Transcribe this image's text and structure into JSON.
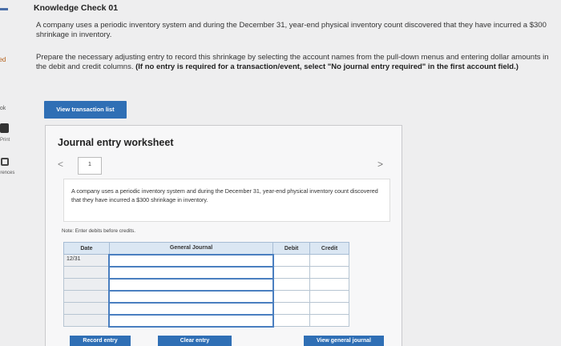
{
  "sidebar": {
    "badge": "ped",
    "book": "ook",
    "print": "Print",
    "references": "erences"
  },
  "page": {
    "title": "Knowledge Check 01",
    "paragraph1": "A company uses a periodic inventory system and during the December 31, year-end physical inventory count discovered that they have incurred a $300 shrinkage in inventory.",
    "paragraph2": "Prepare the necessary adjusting entry to record this shrinkage by selecting the account names from the pull-down menus and entering dollar amounts in the debit and credit columns.",
    "paragraph2_bold": "(If no entry is required for a transaction/event, select \"No journal entry required\" in the first account field.)",
    "view_transactions_label": "View transaction list"
  },
  "worksheet": {
    "title": "Journal entry worksheet",
    "prev_glyph": "<",
    "current_tab": "1",
    "next_glyph": ">",
    "description": "A company uses a periodic inventory system and during the December 31, year-end physical inventory count discovered that they have incurred a $300 shrinkage in inventory.",
    "note": "Note: Enter debits before credits.",
    "table": {
      "headers": {
        "date": "Date",
        "general_journal": "General Journal",
        "debit": "Debit",
        "credit": "Credit"
      },
      "rows": [
        {
          "date": "12/31",
          "account": "",
          "debit": "",
          "credit": ""
        },
        {
          "date": "",
          "account": "",
          "debit": "",
          "credit": ""
        },
        {
          "date": "",
          "account": "",
          "debit": "",
          "credit": ""
        },
        {
          "date": "",
          "account": "",
          "debit": "",
          "credit": ""
        },
        {
          "date": "",
          "account": "",
          "debit": "",
          "credit": ""
        },
        {
          "date": "",
          "account": "",
          "debit": "",
          "credit": ""
        }
      ]
    },
    "buttons": {
      "record": "Record entry",
      "clear": "Clear entry",
      "view_general": "View general journal"
    }
  }
}
